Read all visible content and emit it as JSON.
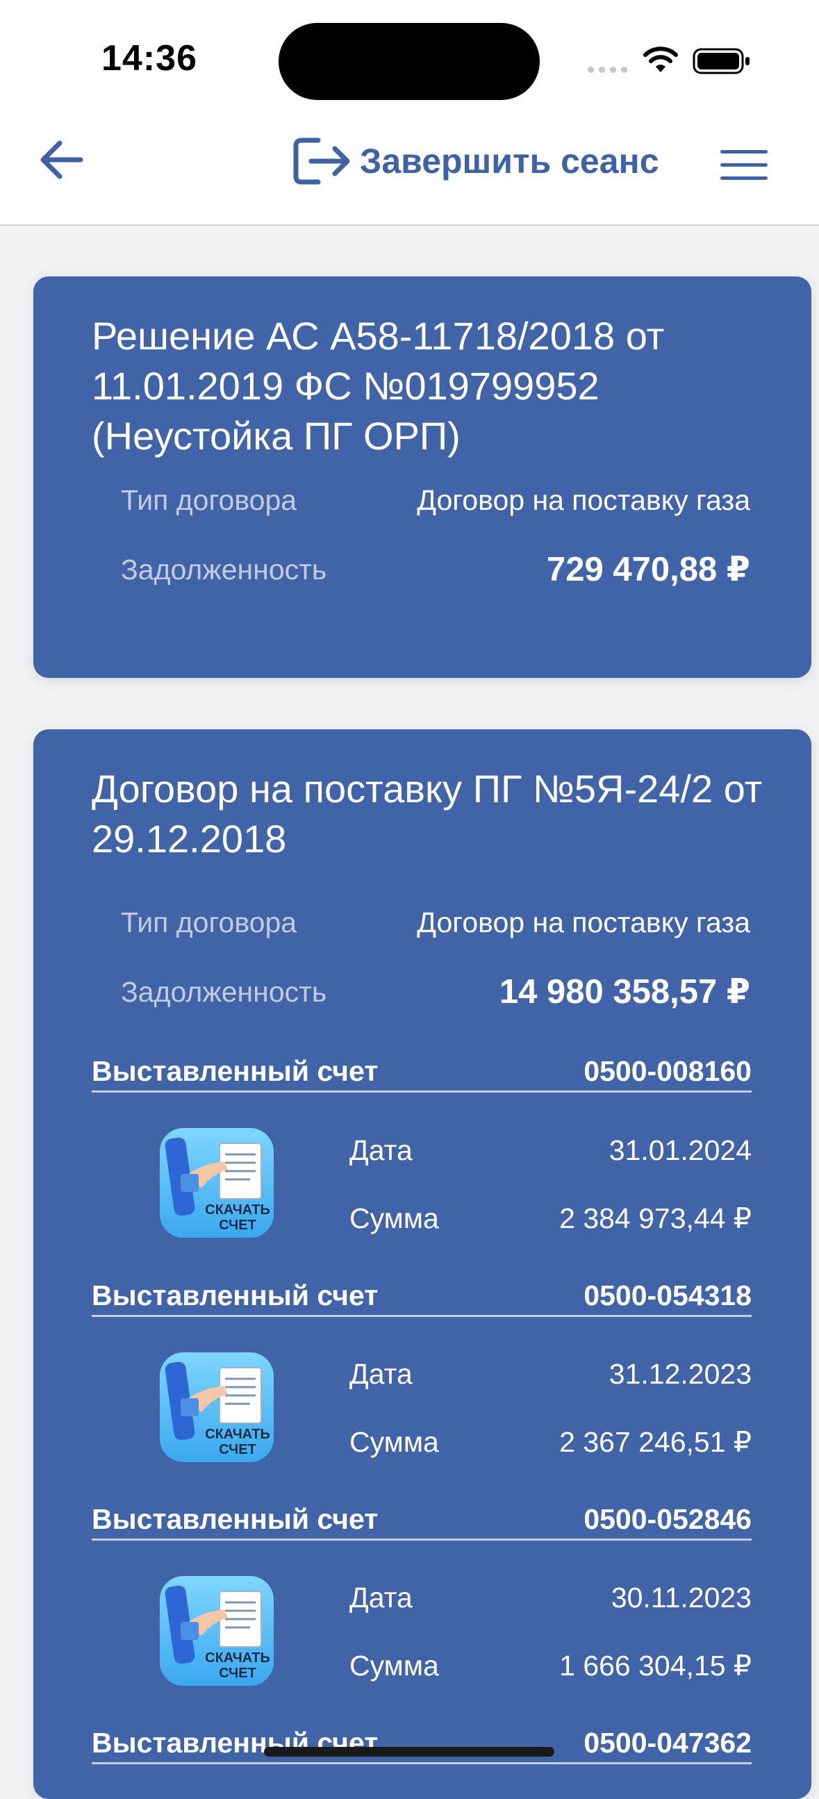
{
  "status_bar": {
    "time": "14:36"
  },
  "header": {
    "logout_label": "Завершить сеанс"
  },
  "cards": [
    {
      "title": "Решение АС А58-11718/2018 от 11.01.2019 ФС №019799952 (Неустойка ПГ ОРП)",
      "type_label": "Тип договора",
      "type_value": "Договор на поставку газа",
      "debt_label": "Задолженность",
      "debt_value": "729 470,88 ₽"
    },
    {
      "title": "Договор на поставку ПГ №5Я-24/2 от 29.12.2018",
      "type_label": "Тип договора",
      "type_value": "Договор на поставку газа",
      "debt_label": "Задолженность",
      "debt_value": "14 980 358,57 ₽",
      "invoices": [
        {
          "label": "Выставленный счет",
          "number": "0500-008160",
          "date_label": "Дата",
          "date": "31.01.2024",
          "sum_label": "Сумма",
          "sum": "2 384 973,44 ₽"
        },
        {
          "label": "Выставленный счет",
          "number": "0500-054318",
          "date_label": "Дата",
          "date": "31.12.2023",
          "sum_label": "Сумма",
          "sum": "2 367 246,51 ₽"
        },
        {
          "label": "Выставленный счет",
          "number": "0500-052846",
          "date_label": "Дата",
          "date": "30.11.2023",
          "sum_label": "Сумма",
          "sum": "1 666 304,15 ₽"
        },
        {
          "label": "Выставленный счет",
          "number": "0500-047362"
        }
      ]
    }
  ],
  "download_icon": {
    "name": "download-invoice-icon",
    "text_top": "СКАЧАТЬ",
    "text_bottom": "СЧЕТ"
  },
  "colors": {
    "accent": "#3f61a6",
    "card": "#4163a8",
    "background": "#f2f2f4"
  }
}
